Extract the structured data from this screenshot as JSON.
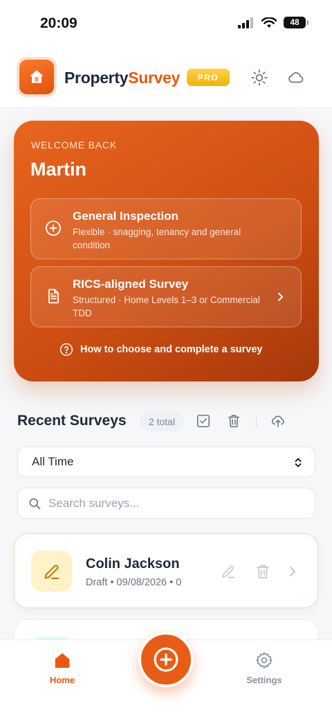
{
  "status_bar": {
    "time": "20:09",
    "battery": "48"
  },
  "header": {
    "brand_part1": "Property",
    "brand_part2": "Survey",
    "badge": "PRO"
  },
  "hero": {
    "subtitle": "WELCOME BACK",
    "user_name": "Martin",
    "options": [
      {
        "title": "General Inspection",
        "description": "Flexible · snagging, tenancy and general condition"
      },
      {
        "title": "RICS-aligned Survey",
        "description": "Structured · Home Levels 1–3 or Commercial TDD"
      }
    ],
    "help_link": "How to choose and complete a survey"
  },
  "recent": {
    "title": "Recent Surveys",
    "count": "2 total",
    "filter_value": "All Time",
    "search_placeholder": "Search surveys..."
  },
  "surveys": [
    {
      "name": "Colin Jackson",
      "meta": "Draft • 09/08/2026 • 0"
    }
  ],
  "tabbar": {
    "home": "Home",
    "settings": "Settings"
  },
  "colors": {
    "accent": "#ea580c",
    "badge": "#f5b100",
    "draft_bg": "#fef3c7"
  }
}
